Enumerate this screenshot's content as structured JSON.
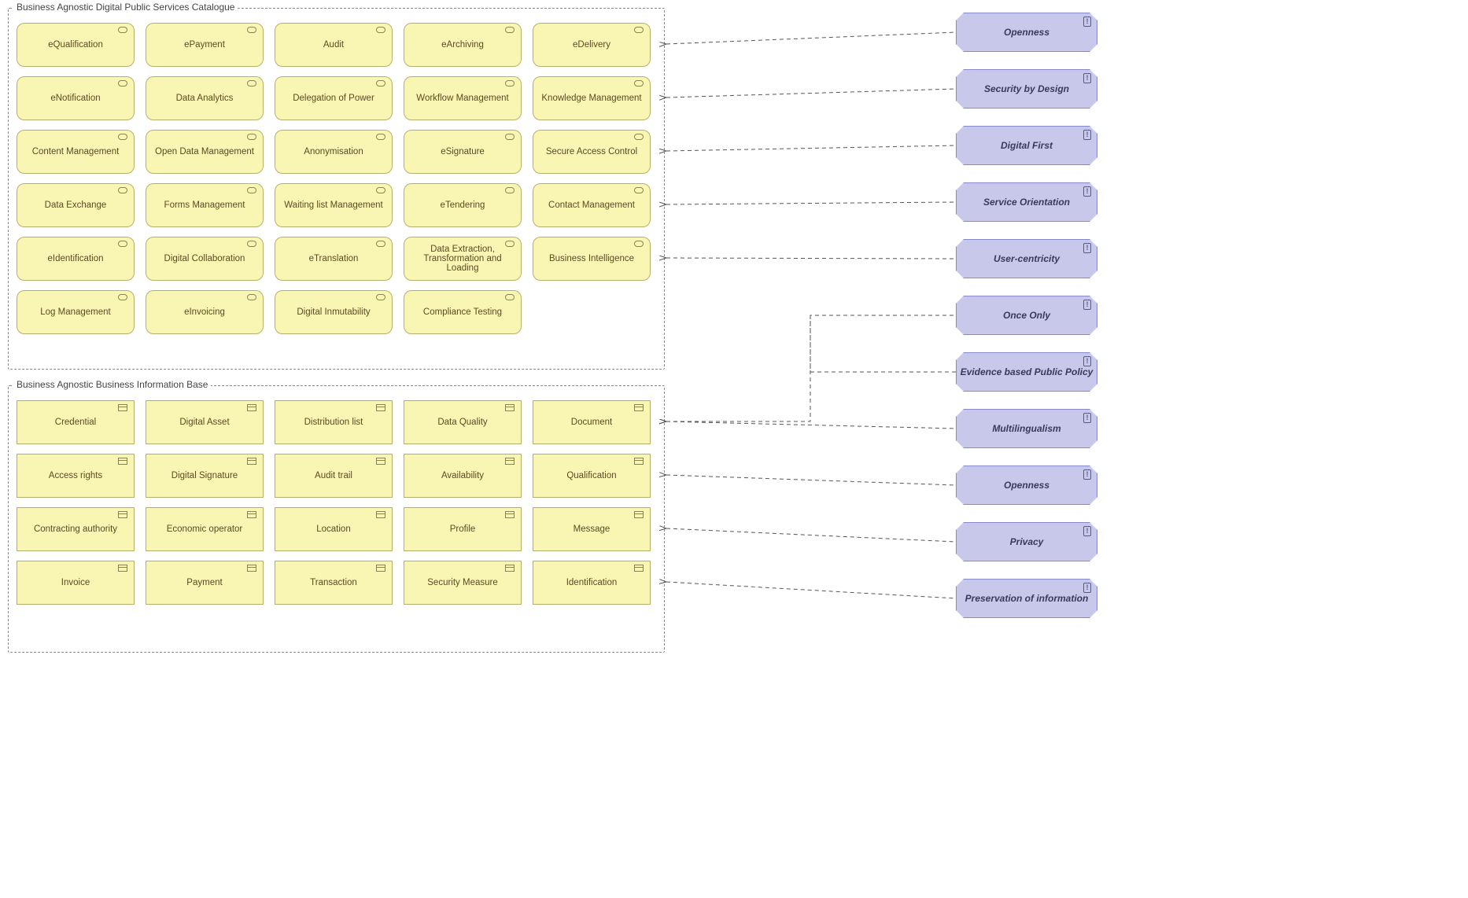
{
  "groups": {
    "services": {
      "title": "Business Agnostic Digital Public Services Catalogue",
      "rows": [
        [
          "eQualification",
          "ePayment",
          "Audit",
          "eArchiving",
          "eDelivery"
        ],
        [
          "eNotification",
          "Data Analytics",
          "Delegation of Power",
          "Workflow Management",
          "Knowledge Management"
        ],
        [
          "Content Management",
          "Open Data Management",
          "Anonymisation",
          "eSignature",
          "Secure Access Control"
        ],
        [
          "Data Exchange",
          "Forms Management",
          "Waiting list Management",
          "eTendering",
          "Contact Management"
        ],
        [
          "eIdentification",
          "Digital Collaboration",
          "eTranslation",
          "Data Extraction, Transformation and Loading",
          "Business Intelligence"
        ],
        [
          "Log Management",
          "eInvoicing",
          "Digital Inmutability",
          "Compliance Testing"
        ]
      ]
    },
    "information": {
      "title": "Business Agnostic Business Information Base",
      "rows": [
        [
          "Credential",
          "Digital Asset",
          "Distribution list",
          "Data Quality",
          "Document"
        ],
        [
          "Access rights",
          "Digital Signature",
          "Audit trail",
          "Availability",
          "Qualification"
        ],
        [
          "Contracting authority",
          "Economic operator",
          "Location",
          "Profile",
          "Message"
        ],
        [
          "Invoice",
          "Payment",
          "Transaction",
          "Security Measure",
          "Identification"
        ]
      ]
    }
  },
  "principles": [
    "Openness",
    "Security by Design",
    "Digital First",
    "Service Orientation",
    "User-centricity",
    "Once Only",
    "Evidence based Public Policy",
    "Multilingualism",
    "Openness",
    "Privacy",
    "Preservation of information"
  ]
}
